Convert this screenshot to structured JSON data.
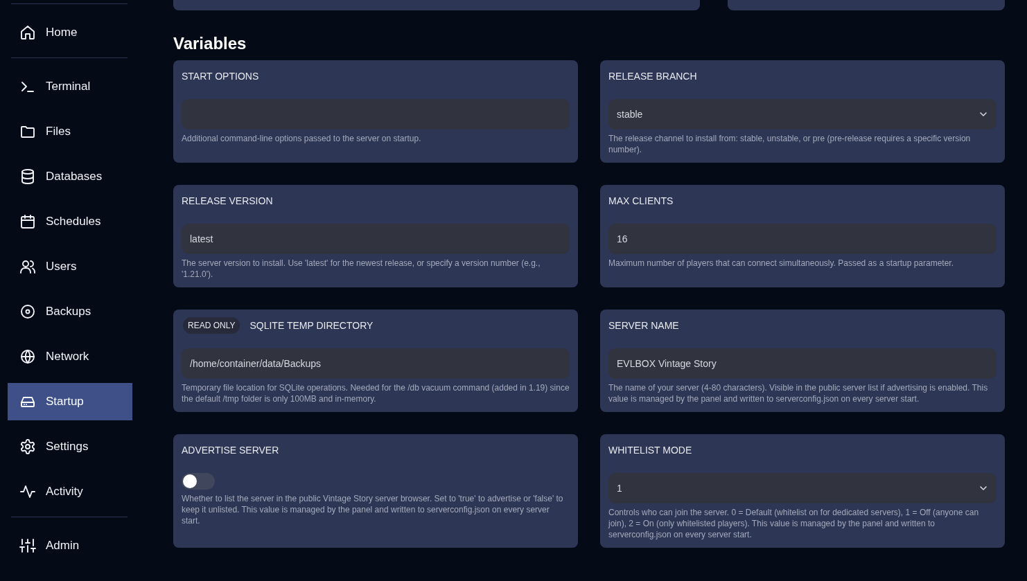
{
  "sidebar": {
    "sections": [
      {
        "items": [
          {
            "label": "Home",
            "selected": false
          }
        ]
      },
      {
        "items": [
          {
            "label": "Terminal",
            "selected": false
          },
          {
            "label": "Files",
            "selected": false
          },
          {
            "label": "Databases",
            "selected": false
          },
          {
            "label": "Schedules",
            "selected": false
          },
          {
            "label": "Users",
            "selected": false
          },
          {
            "label": "Backups",
            "selected": false
          },
          {
            "label": "Network",
            "selected": false
          },
          {
            "label": "Startup",
            "selected": true
          },
          {
            "label": "Settings",
            "selected": false
          },
          {
            "label": "Activity",
            "selected": false
          }
        ]
      },
      {
        "items": [
          {
            "label": "Admin",
            "selected": false
          }
        ]
      }
    ]
  },
  "content": {
    "title": "Variables",
    "variables": [
      {
        "label": "START OPTIONS",
        "kind": "text",
        "description": "Additional command-line options passed to the server on startup."
      },
      {
        "label": "RELEASE BRANCH",
        "kind": "select",
        "value": "stable",
        "description": "The release channel to install from: stable, unstable, or pre (pre-release requires a specific version number)."
      },
      {
        "label": "RELEASE VERSION",
        "kind": "text",
        "value": "latest",
        "description": "The server version to install. Use 'latest' for the newest release, or specify a version number (e.g., '1.21.0')."
      },
      {
        "label": "MAX CLIENTS",
        "kind": "text",
        "value": "16",
        "description": "Maximum number of players that can connect simultaneously. Passed as a startup parameter."
      },
      {
        "label": "SQLITE TEMP DIRECTORY",
        "badge": "READ ONLY",
        "kind": "text",
        "value": "/home/container/data/Backups",
        "description": "Temporary file location for SQLite operations. Needed for the /db vacuum command (added in 1.19) since the default /tmp folder is only 100MB and in-memory."
      },
      {
        "label": "SERVER NAME",
        "kind": "text",
        "value": "EVLBOX Vintage Story",
        "description": "The name of your server (4-80 characters). Visible in the public server list if advertising is enabled. This value is managed by the panel and written to serverconfig.json on every server start."
      },
      {
        "label": "ADVERTISE SERVER",
        "kind": "toggle",
        "on": false,
        "description": "Whether to list the server in the public Vintage Story server browser. Set to 'true' to advertise or 'false' to keep it unlisted. This value is managed by the panel and written to serverconfig.json on every server start."
      },
      {
        "label": "WHITELIST MODE",
        "kind": "select",
        "value": "1",
        "description": "Controls who can join the server. 0 = Default (whitelist on for dedicated servers), 1 = Off (anyone can join), 2 = On (only whitelisted players). This value is managed by the panel and written to serverconfig.json on every server start."
      }
    ]
  }
}
